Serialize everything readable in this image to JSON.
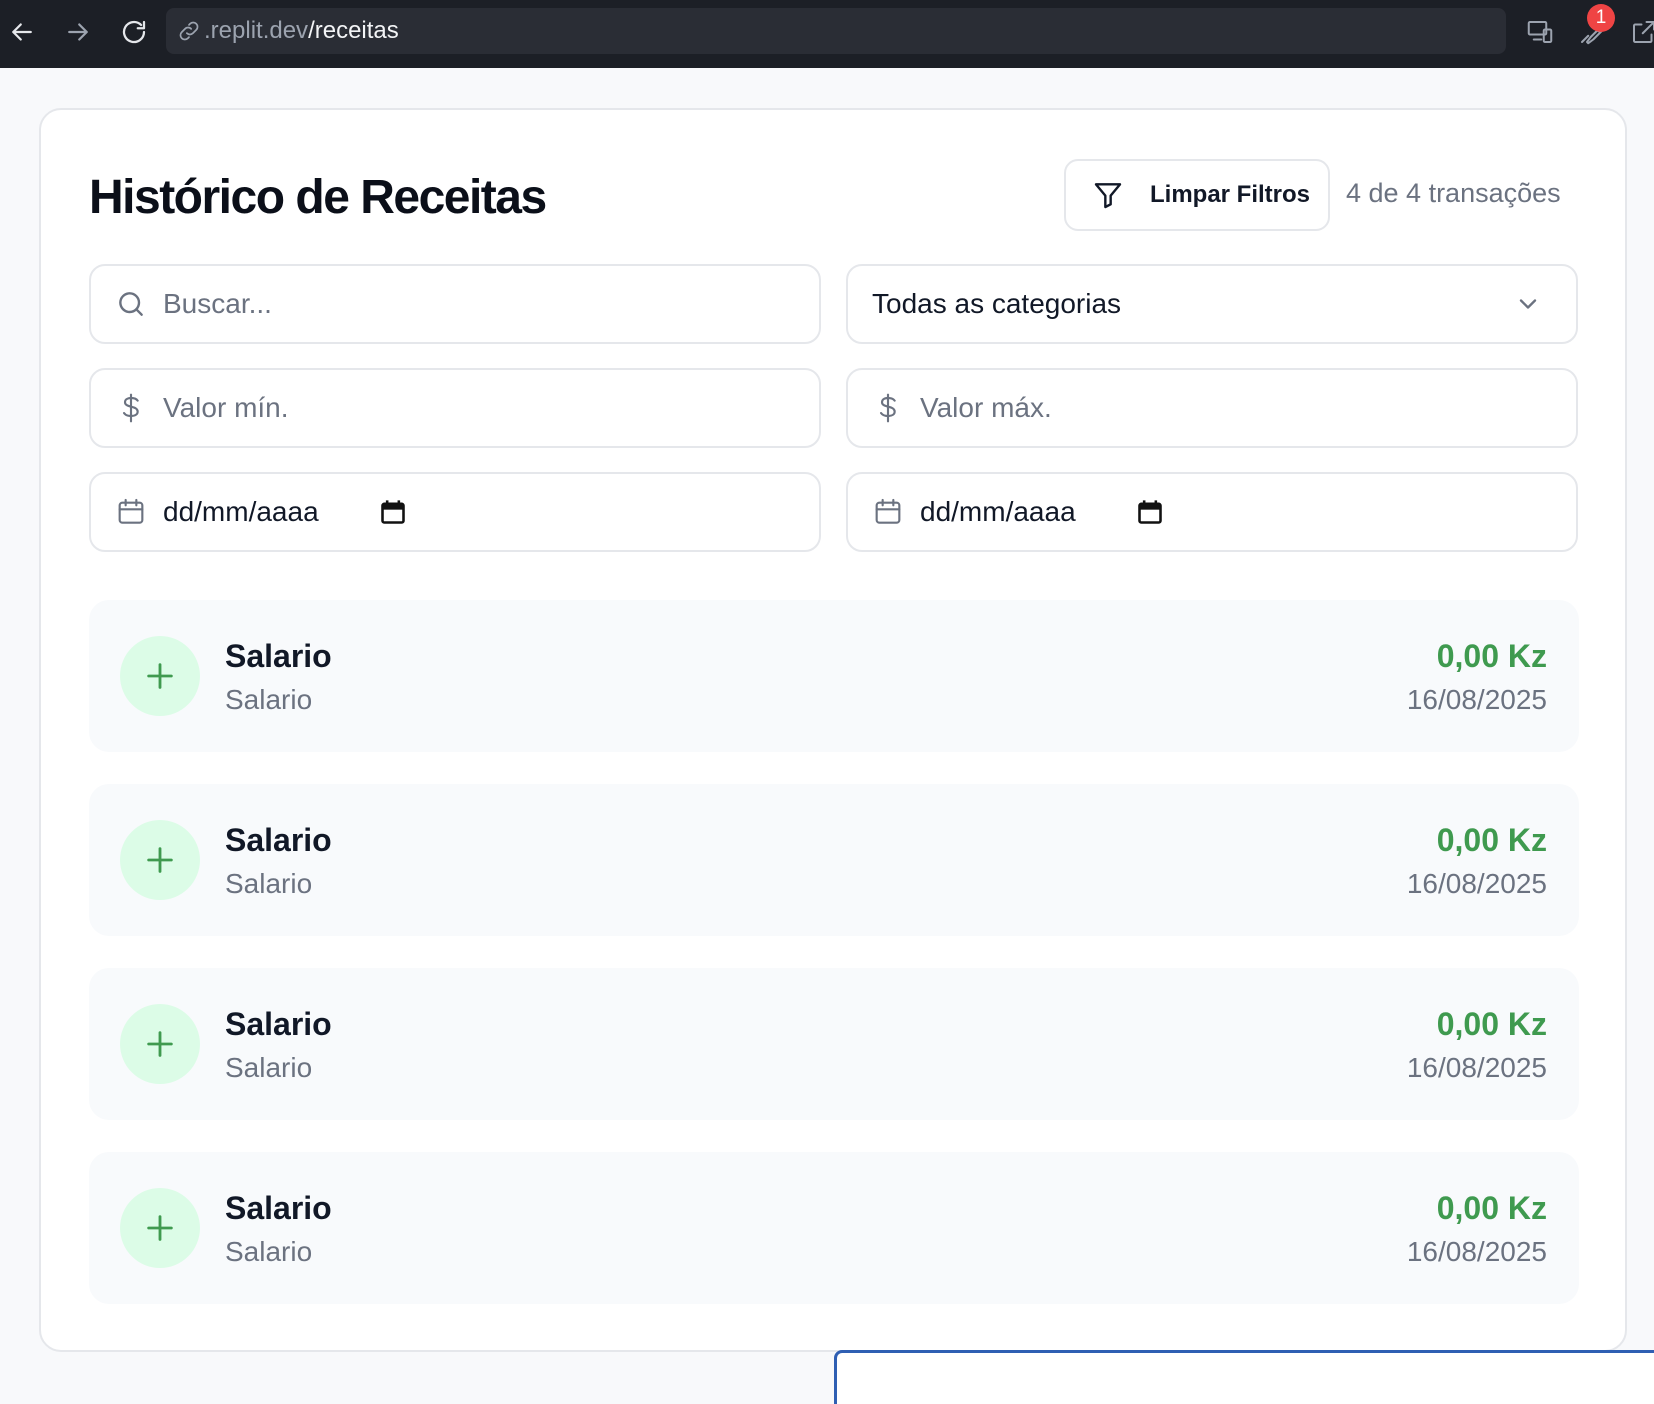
{
  "browser": {
    "url_host": ".replit.dev",
    "url_path": "/receitas",
    "notification_count": "1"
  },
  "page": {
    "title": "Histórico de Receitas",
    "clear_filters_label": "Limpar Filtros",
    "count_text": "4 de 4 transações"
  },
  "filters": {
    "search_placeholder": "Buscar...",
    "category_selected": "Todas as categorias",
    "min_value_placeholder": "Valor mín.",
    "max_value_placeholder": "Valor máx.",
    "date_from": "dd/mm/aaaa",
    "date_to": "dd/mm/aaaa"
  },
  "transactions": [
    {
      "name": "Salario",
      "category": "Salario",
      "amount": "0,00 Kz",
      "date": "16/08/2025"
    },
    {
      "name": "Salario",
      "category": "Salario",
      "amount": "0,00 Kz",
      "date": "16/08/2025"
    },
    {
      "name": "Salario",
      "category": "Salario",
      "amount": "0,00 Kz",
      "date": "16/08/2025"
    },
    {
      "name": "Salario",
      "category": "Salario",
      "amount": "0,00 Kz",
      "date": "16/08/2025"
    }
  ],
  "colors": {
    "income_green": "#3f9a4f",
    "income_icon_bg": "#dcfce7",
    "browser_bar": "#1c1f26"
  }
}
